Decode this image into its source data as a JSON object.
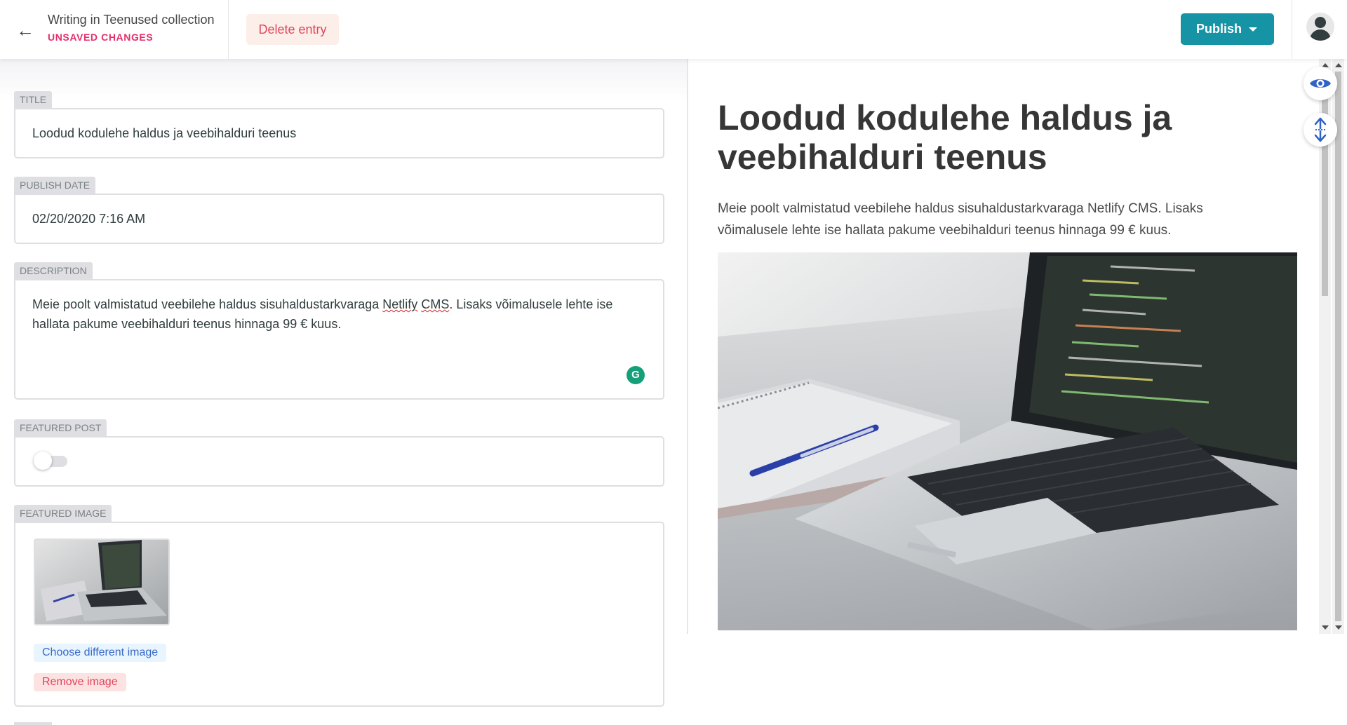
{
  "header": {
    "back_icon": "arrow-left-icon",
    "collection_title": "Writing in Teenused collection",
    "status": "UNSAVED CHANGES",
    "delete_label": "Delete entry",
    "publish_label": "Publish",
    "avatar_icon": "user-avatar-icon"
  },
  "fields": {
    "title": {
      "label": "TITLE",
      "value": "Loodud kodulehe haldus ja veebihalduri teenus"
    },
    "publish_date": {
      "label": "PUBLISH DATE",
      "value": "02/20/2020 7:16 AM"
    },
    "description": {
      "label": "DESCRIPTION",
      "text_before": "Meie poolt valmistatud veebilehe haldus sisuhaldustarkvaraga ",
      "word1": "Netlify",
      "space": " ",
      "word2": "CMS",
      "text_after": ". Lisaks võimalusele lehte ise hallata pakume veebihalduri teenus hinnaga 99 € kuus."
    },
    "featured_post": {
      "label": "FEATURED POST",
      "checked": false
    },
    "featured_image": {
      "label": "FEATURED IMAGE",
      "choose_label": "Choose different image",
      "remove_label": "Remove image"
    }
  },
  "preview": {
    "title": "Loodud kodulehe haldus ja veebihalduri teenus",
    "description": "Meie poolt valmistatud veebilehe haldus sisuhaldustarkvaraga Netlify CMS. Lisaks võimalusele lehte ise hallata pakume veebihalduri teenus hinnaga 99 € kuus."
  },
  "colors": {
    "accent": "#1693a5",
    "danger": "#e0465c",
    "unsaved": "#e52e6b",
    "link": "#3a69c7"
  },
  "icons": [
    "arrow-left-icon",
    "caret-down-icon",
    "user-avatar-icon",
    "grammarly-icon",
    "eye-icon",
    "sync-scroll-icon"
  ]
}
